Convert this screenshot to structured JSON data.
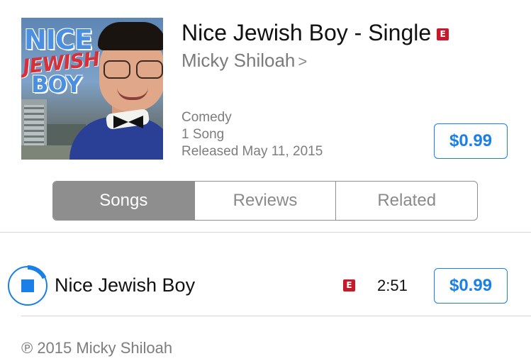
{
  "album": {
    "title": "Nice Jewish Boy - Single",
    "explicit_badge": "E",
    "artist": "Micky Shiloah",
    "artist_chevron": ">",
    "genre": "Comedy",
    "song_count": "1 Song",
    "release": "Released May 11, 2015",
    "price": "$0.99",
    "art_text": {
      "line1": "NICE",
      "line2": "JEWISH",
      "line3": "BOY"
    }
  },
  "tabs": [
    {
      "label": "Songs",
      "active": true
    },
    {
      "label": "Reviews",
      "active": false
    },
    {
      "label": "Related",
      "active": false
    }
  ],
  "tracks": [
    {
      "name": "Nice Jewish Boy",
      "explicit_badge": "E",
      "duration": "2:51",
      "price": "$0.99",
      "preview_progress": 0.18
    }
  ],
  "copyright": "℗ 2015 Micky Shiloah",
  "colors": {
    "accent": "#1a7fe6",
    "explicit": "#c41a2c",
    "segment_active": "#8e8e8e",
    "secondary_text": "#7d7d7d"
  },
  "icons": {
    "preview": "stop-preview-icon",
    "artist_link": "chevron-right-icon"
  }
}
